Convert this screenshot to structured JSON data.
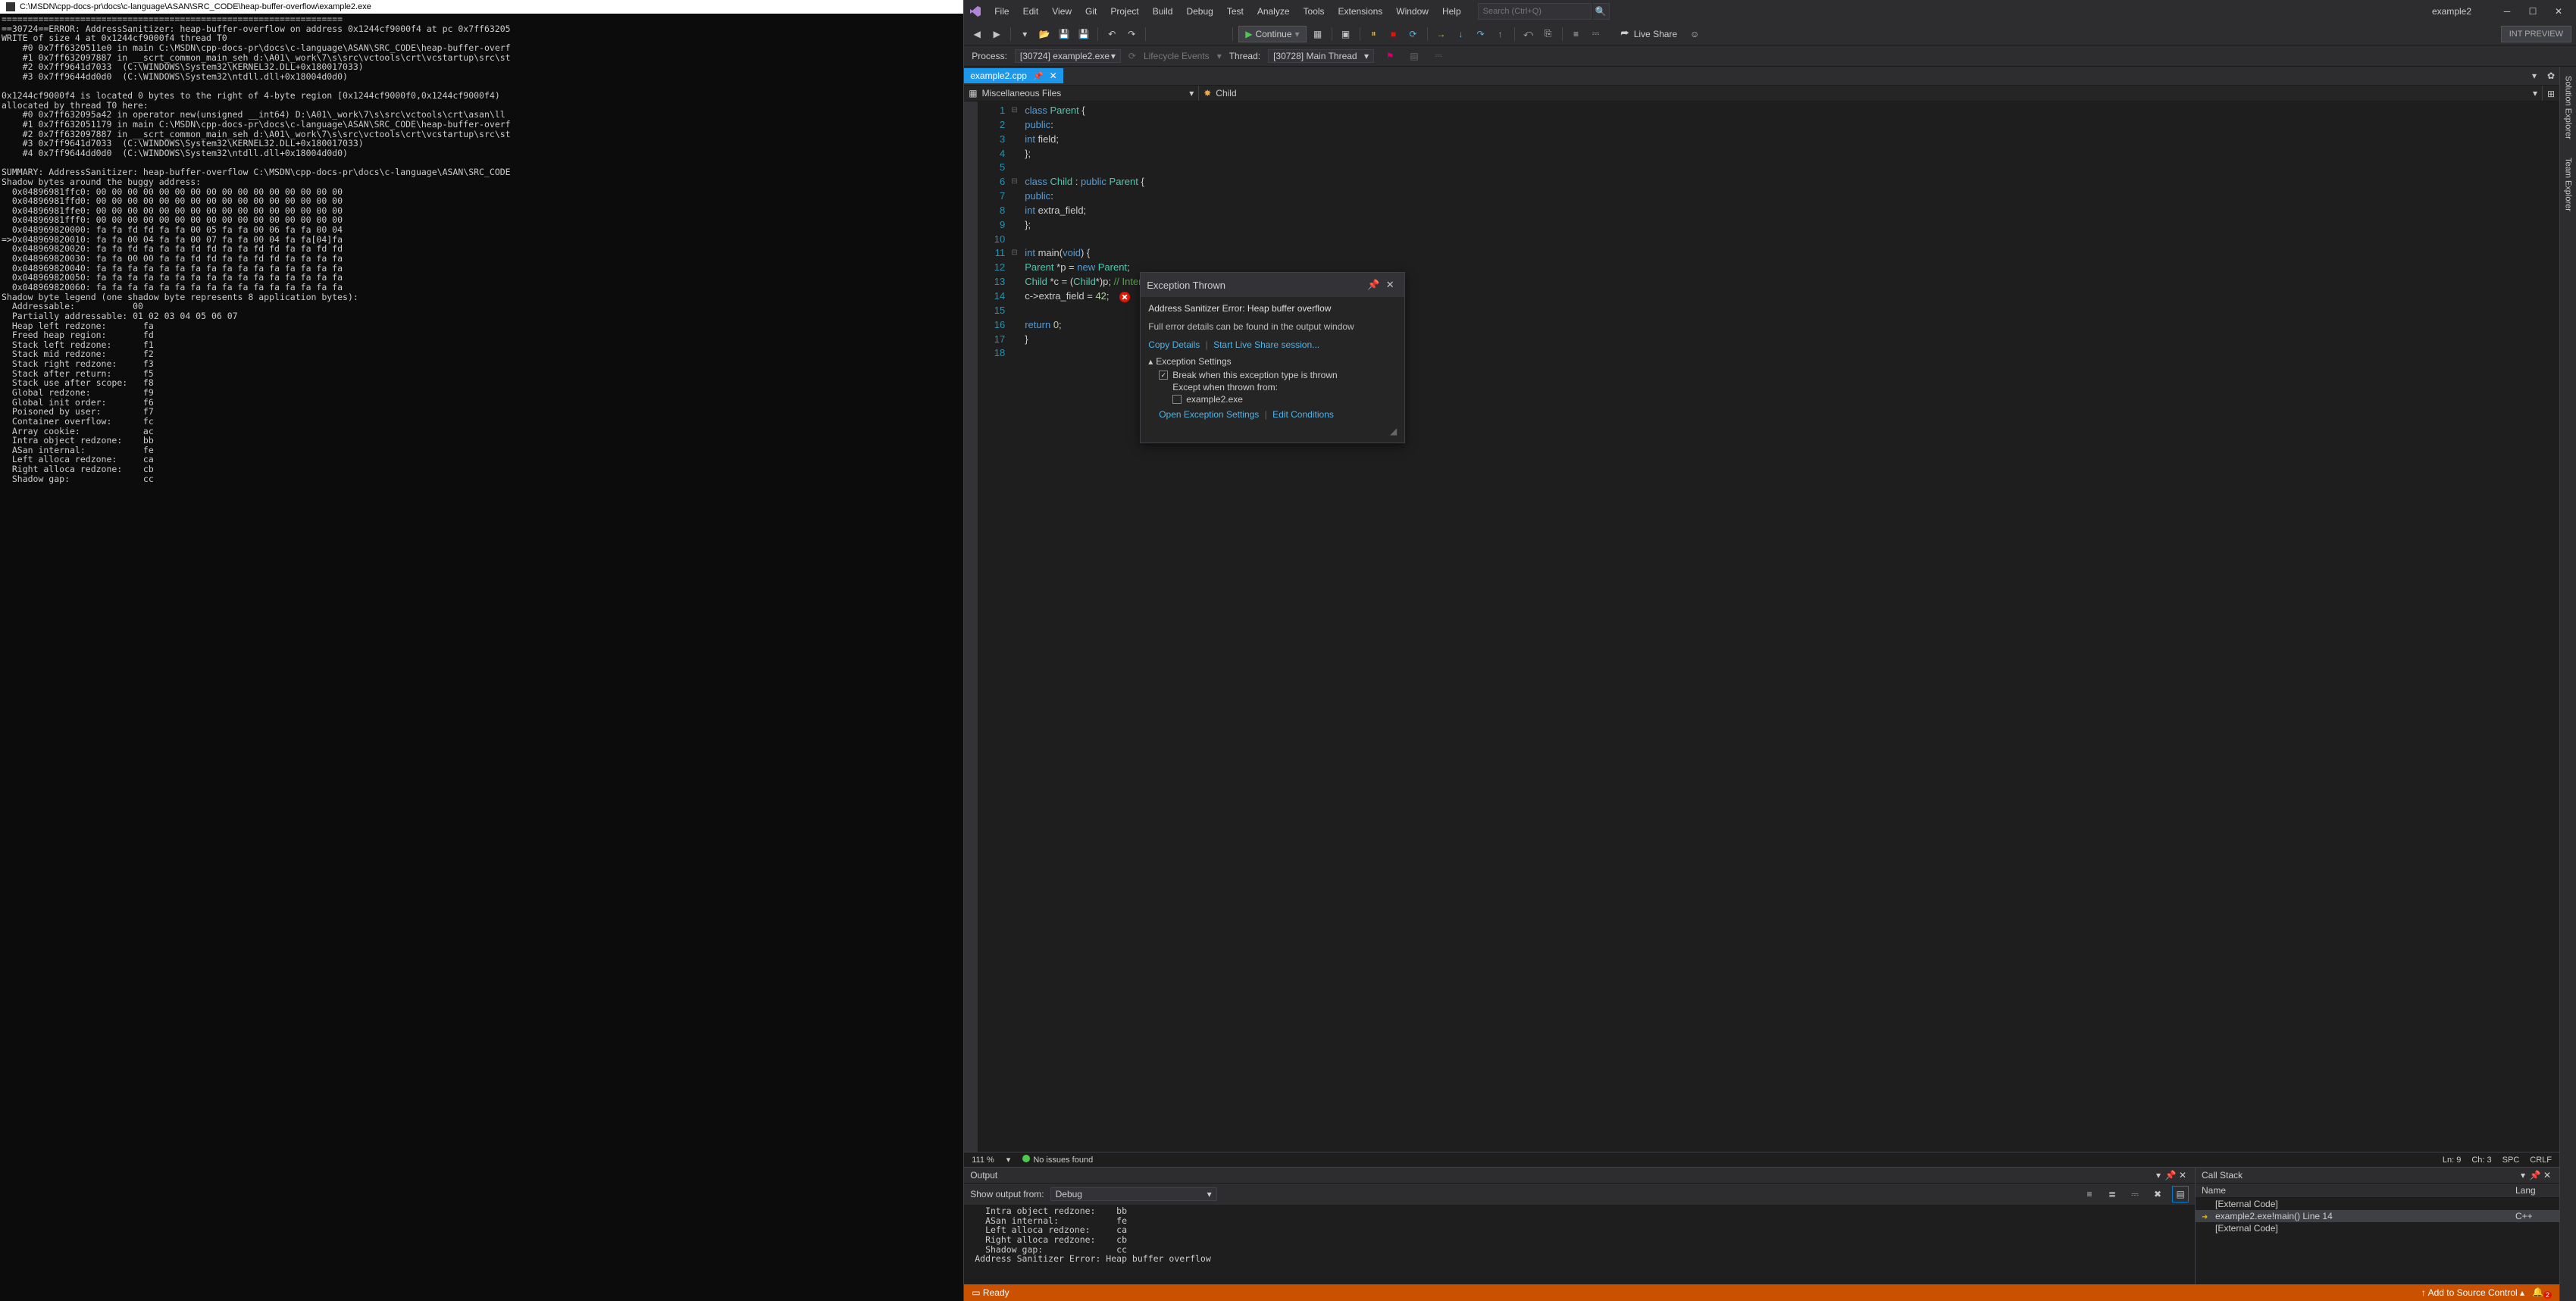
{
  "console": {
    "title_path": "C:\\MSDN\\cpp-docs-pr\\docs\\c-language\\ASAN\\SRC_CODE\\heap-buffer-overflow\\example2.exe",
    "text": "=================================================================\n==30724==ERROR: AddressSanitizer: heap-buffer-overflow on address 0x1244cf9000f4 at pc 0x7ff63205\nWRITE of size 4 at 0x1244cf9000f4 thread T0\n    #0 0x7ff6320511e0 in main C:\\MSDN\\cpp-docs-pr\\docs\\c-language\\ASAN\\SRC_CODE\\heap-buffer-overf\n    #1 0x7ff632097887 in __scrt_common_main_seh d:\\A01\\_work\\7\\s\\src\\vctools\\crt\\vcstartup\\src\\st\n    #2 0x7ff9641d7033  (C:\\WINDOWS\\System32\\KERNEL32.DLL+0x180017033)\n    #3 0x7ff9644dd0d0  (C:\\WINDOWS\\System32\\ntdll.dll+0x18004d0d0)\n\n0x1244cf9000f4 is located 0 bytes to the right of 4-byte region [0x1244cf9000f0,0x1244cf9000f4)\nallocated by thread T0 here:\n    #0 0x7ff632095a42 in operator new(unsigned __int64) D:\\A01\\_work\\7\\s\\src\\vctools\\crt\\asan\\ll\n    #1 0x7ff632051179 in main C:\\MSDN\\cpp-docs-pr\\docs\\c-language\\ASAN\\SRC_CODE\\heap-buffer-overf\n    #2 0x7ff632097887 in __scrt_common_main_seh d:\\A01\\_work\\7\\s\\src\\vctools\\crt\\vcstartup\\src\\st\n    #3 0x7ff9641d7033  (C:\\WINDOWS\\System32\\KERNEL32.DLL+0x180017033)\n    #4 0x7ff9644dd0d0  (C:\\WINDOWS\\System32\\ntdll.dll+0x18004d0d0)\n\nSUMMARY: AddressSanitizer: heap-buffer-overflow C:\\MSDN\\cpp-docs-pr\\docs\\c-language\\ASAN\\SRC_CODE\nShadow bytes around the buggy address:\n  0x04896981ffc0: 00 00 00 00 00 00 00 00 00 00 00 00 00 00 00 00\n  0x04896981ffd0: 00 00 00 00 00 00 00 00 00 00 00 00 00 00 00 00\n  0x04896981ffe0: 00 00 00 00 00 00 00 00 00 00 00 00 00 00 00 00\n  0x04896981fff0: 00 00 00 00 00 00 00 00 00 00 00 00 00 00 00 00\n  0x048969820000: fa fa fd fd fa fa 00 05 fa fa 00 06 fa fa 00 04\n=>0x048969820010: fa fa 00 04 fa fa 00 07 fa fa 00 04 fa fa[04]fa\n  0x048969820020: fa fa fd fa fa fa fd fd fa fa fd fd fa fa fd fd\n  0x048969820030: fa fa 00 00 fa fa fd fd fa fa fd fd fa fa fa fa\n  0x048969820040: fa fa fa fa fa fa fa fa fa fa fa fa fa fa fa fa\n  0x048969820050: fa fa fa fa fa fa fa fa fa fa fa fa fa fa fa fa\n  0x048969820060: fa fa fa fa fa fa fa fa fa fa fa fa fa fa fa fa\nShadow byte legend (one shadow byte represents 8 application bytes):\n  Addressable:           00\n  Partially addressable: 01 02 03 04 05 06 07\n  Heap left redzone:       fa\n  Freed heap region:       fd\n  Stack left redzone:      f1\n  Stack mid redzone:       f2\n  Stack right redzone:     f3\n  Stack after return:      f5\n  Stack use after scope:   f8\n  Global redzone:          f9\n  Global init order:       f6\n  Poisoned by user:        f7\n  Container overflow:      fc\n  Array cookie:            ac\n  Intra object redzone:    bb\n  ASan internal:           fe\n  Left alloca redzone:     ca\n  Right alloca redzone:    cb\n  Shadow gap:              cc"
  },
  "vs": {
    "menu": [
      "File",
      "Edit",
      "View",
      "Git",
      "Project",
      "Build",
      "Debug",
      "Test",
      "Analyze",
      "Tools",
      "Extensions",
      "Window",
      "Help"
    ],
    "search_placeholder": "Search (Ctrl+Q)",
    "solution_name": "example2",
    "continue_label": "Continue",
    "live_share": "Live Share",
    "int_preview": "INT PREVIEW",
    "process_label": "Process:",
    "process_value": "[30724] example2.exe",
    "lifecycle_label": "Lifecycle Events",
    "thread_label": "Thread:",
    "thread_value": "[30728] Main Thread",
    "side_tabs": [
      "Solution Explorer",
      "Team Explorer"
    ],
    "tab_name": "example2.cpp",
    "nav_scope": "Miscellaneous Files",
    "nav_member": "Child",
    "code_lines": [
      {
        "n": 1,
        "html": "<span class='kw'>class</span> <span class='typ'>Parent</span> {"
      },
      {
        "n": 2,
        "html": " <span class='kw'>public</span>:"
      },
      {
        "n": 3,
        "html": "  <span class='kw'>int</span> field;"
      },
      {
        "n": 4,
        "html": " };"
      },
      {
        "n": 5,
        "html": ""
      },
      {
        "n": 6,
        "html": "<span class='kw'>class</span> <span class='typ'>Child</span> : <span class='kw'>public</span> <span class='typ'>Parent</span> {"
      },
      {
        "n": 7,
        "html": " <span class='kw'>public</span>:"
      },
      {
        "n": 8,
        "html": "  <span class='kw'>int</span> extra_field;"
      },
      {
        "n": 9,
        "html": " };"
      },
      {
        "n": 10,
        "html": ""
      },
      {
        "n": 11,
        "html": "<span class='kw'>int</span> <span>main</span>(<span class='kw'>void</span>) {"
      },
      {
        "n": 12,
        "html": "  <span class='typ'>Parent</span> *p = <span class='kw'>new</span> <span class='typ'>Parent</span>;"
      },
      {
        "n": 13,
        "html": "  <span class='typ'>Child</span> *c = (<span class='typ'>Child</span>*)p;  <span class='cmt'>// Intentional error here!</span>"
      },
      {
        "n": 14,
        "html": "  c->extra_field = <span class='num'>42</span>;  <span class='err-icon'></span>"
      },
      {
        "n": 15,
        "html": ""
      },
      {
        "n": 16,
        "html": "  <span class='kw'>return</span> <span class='num'>0</span>;"
      },
      {
        "n": 17,
        "html": " }"
      },
      {
        "n": 18,
        "html": ""
      }
    ],
    "exception": {
      "title": "Exception Thrown",
      "message": "Address Sanitizer Error: Heap buffer overflow",
      "sub": "Full error details can be found in the output window",
      "copy": "Copy Details",
      "liveshare": "Start Live Share session...",
      "settings_title": "Exception Settings",
      "break_label": "Break when this exception type is thrown",
      "except_label": "Except when thrown from:",
      "except_item": "example2.exe",
      "open_settings": "Open Exception Settings",
      "edit_cond": "Edit Conditions"
    },
    "editor_status": {
      "zoom": "111 %",
      "issues": "No issues found",
      "ln": "Ln: 9",
      "ch": "Ch: 3",
      "spc": "SPC",
      "crlf": "CRLF"
    },
    "output": {
      "title": "Output",
      "show_from_label": "Show output from:",
      "show_from_value": "Debug",
      "text": "  Intra object redzone:    bb\n  ASan internal:           fe\n  Left alloca redzone:     ca\n  Right alloca redzone:    cb\n  Shadow gap:              cc\nAddress Sanitizer Error: Heap buffer overflow"
    },
    "callstack": {
      "title": "Call Stack",
      "col_name": "Name",
      "col_lang": "Lang",
      "rows": [
        {
          "name": "[External Code]",
          "lang": "",
          "active": false
        },
        {
          "name": "example2.exe!main() Line 14",
          "lang": "C++",
          "active": true
        },
        {
          "name": "[External Code]",
          "lang": "",
          "active": false
        }
      ]
    },
    "status": {
      "ready": "Ready",
      "add_source": "Add to Source Control"
    }
  }
}
